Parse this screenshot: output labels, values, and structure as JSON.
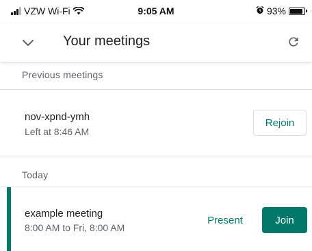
{
  "status_bar": {
    "carrier": "VZW Wi-Fi",
    "time": "9:05 AM",
    "battery": "93%",
    "battery_level": 0.93
  },
  "header": {
    "title": "Your meetings",
    "collapse_icon": "chevron-down-icon",
    "refresh_icon": "refresh-icon"
  },
  "previous": {
    "section_label": "Previous meetings",
    "meeting": {
      "name": "nov-xpnd-ymh",
      "detail": "Left at 8:46 AM",
      "rejoin_label": "Rejoin"
    }
  },
  "today": {
    "section_label": "Today",
    "meeting": {
      "name": "example meeting",
      "detail": "8:00 AM to Fri, 8:00 AM",
      "present_label": "Present",
      "join_label": "Join"
    }
  },
  "colors": {
    "accent": "#00796b",
    "secondary_text": "#5f6368",
    "primary_text": "#202124"
  }
}
